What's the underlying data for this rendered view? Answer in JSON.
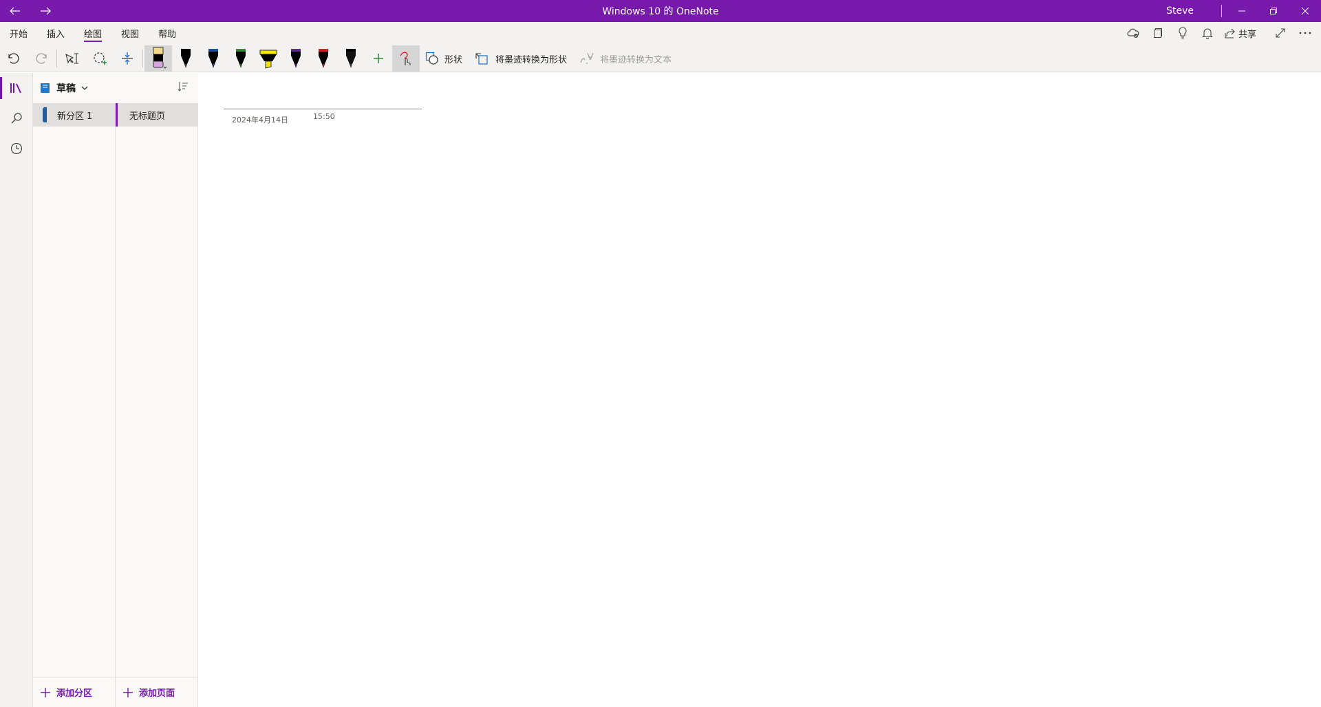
{
  "titlebar": {
    "title": "Windows 10 的 OneNote",
    "user": "Steve"
  },
  "ribbon": {
    "tabs": [
      {
        "label": "开始",
        "active": false
      },
      {
        "label": "插入",
        "active": false
      },
      {
        "label": "绘图",
        "active": true
      },
      {
        "label": "视图",
        "active": false
      },
      {
        "label": "帮助",
        "active": false
      }
    ],
    "share_label": "共享",
    "shapes_label": "形状",
    "ink_to_shape_label": "将墨迹转换为形状",
    "ink_to_text_label": "将墨迹转换为文本",
    "pen_colors": [
      "#000000",
      "#1f4e9c",
      "#2e8b3a",
      "#f5e400",
      "#5b2d8e",
      "#d21f26",
      "#000000"
    ],
    "accent": "#7719aa"
  },
  "notebook": {
    "name": "草稿",
    "sections": [
      {
        "name": "新分区 1",
        "color": "#1f5c99"
      }
    ],
    "pages": [
      {
        "name": "无标题页"
      }
    ],
    "add_section_label": "添加分区",
    "add_page_label": "添加页面"
  },
  "page": {
    "date": "2024年4月14日",
    "time": "15:50"
  }
}
